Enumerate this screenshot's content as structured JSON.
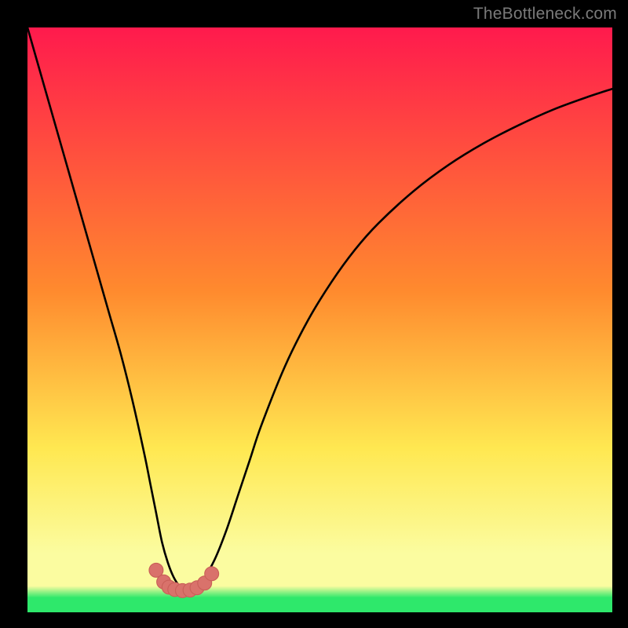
{
  "watermark": "TheBottleneck.com",
  "colors": {
    "top": "#ff1a4d",
    "mid_orange": "#ff8a2e",
    "mid_yellow": "#ffe851",
    "pale_yellow": "#fbfca0",
    "green": "#2ee86b",
    "curve_stroke": "#000000",
    "marker_fill": "#d9726b",
    "marker_stroke": "#c95f58"
  },
  "chart_data": {
    "type": "line",
    "title": "",
    "xlabel": "",
    "ylabel": "",
    "xlim": [
      0,
      100
    ],
    "ylim": [
      0,
      100
    ],
    "series": [
      {
        "name": "bottleneck-curve",
        "x": [
          0,
          2,
          4,
          6,
          8,
          10,
          12,
          14,
          16,
          18,
          20,
          21,
          22,
          23,
          24,
          25,
          26,
          27,
          28,
          29,
          30,
          32,
          34,
          36,
          38,
          40,
          44,
          48,
          52,
          56,
          60,
          66,
          72,
          78,
          84,
          90,
          96,
          100
        ],
        "y": [
          100,
          93,
          86,
          79,
          72,
          65,
          58,
          51,
          44,
          36,
          27,
          22,
          17,
          12,
          8.5,
          6,
          4.5,
          4,
          4,
          4.5,
          5.5,
          9,
          14,
          20,
          26,
          32,
          42,
          50,
          56.5,
          62,
          66.5,
          72,
          76.5,
          80.2,
          83.3,
          86,
          88.2,
          89.5
        ]
      }
    ],
    "markers": {
      "x": [
        22.0,
        23.3,
        24.2,
        25.2,
        26.5,
        27.8,
        29.0,
        30.3,
        31.5
      ],
      "y": [
        7.2,
        5.2,
        4.3,
        3.9,
        3.7,
        3.8,
        4.2,
        5.0,
        6.6
      ],
      "r": [
        1.2,
        1.2,
        1.2,
        1.2,
        1.2,
        1.2,
        1.2,
        1.2,
        1.2
      ]
    },
    "gradient_stops": [
      {
        "offset": 0.0,
        "color_ref": "top"
      },
      {
        "offset": 0.45,
        "color_ref": "mid_orange"
      },
      {
        "offset": 0.72,
        "color_ref": "mid_yellow"
      },
      {
        "offset": 0.9,
        "color_ref": "pale_yellow"
      },
      {
        "offset": 0.955,
        "color_ref": "pale_yellow"
      },
      {
        "offset": 0.975,
        "color_ref": "green"
      },
      {
        "offset": 1.0,
        "color_ref": "green"
      }
    ]
  }
}
